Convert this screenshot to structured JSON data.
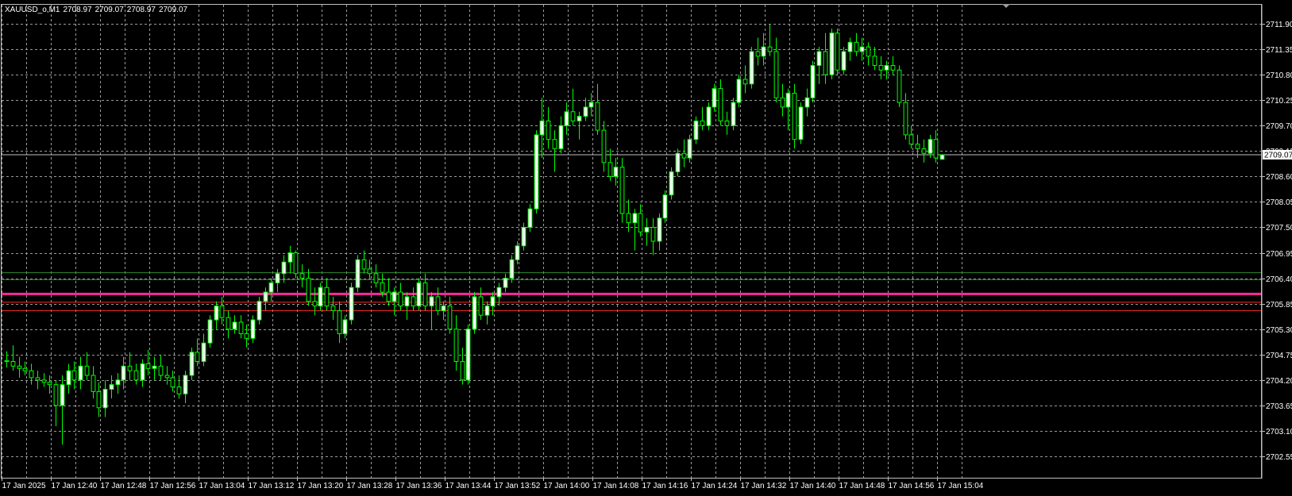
{
  "symbol_label": "XAUUSD_o,M1",
  "ohlc": {
    "open": "2708.97",
    "high": "2709.07",
    "low": "2708.97",
    "close": "2709.07"
  },
  "current_price_label": "2709.07",
  "colors": {
    "background": "#000000",
    "grid": "#9a9a9a",
    "bull_candle": "#ffffff",
    "bear_candle": "#000000",
    "wick": "#00ff00",
    "price_line": "#c0c0c0",
    "magenta_line": "#ff2aa0",
    "red_line": "#ff2a2a",
    "green_line": "#2e8b2e"
  },
  "chart_data": {
    "type": "candlestick",
    "symbol": "XAUUSD_o",
    "timeframe": "M1",
    "ylim": [
      2702.55,
      2712.2
    ],
    "y_ticks": [
      "2711.90",
      "2711.35",
      "2710.80",
      "2710.25",
      "2709.70",
      "2709.15",
      "2708.60",
      "2708.05",
      "2707.50",
      "2706.95",
      "2706.40",
      "2705.85",
      "2705.30",
      "2704.75",
      "2704.20",
      "2703.65",
      "2703.10",
      "2702.55"
    ],
    "x_ticks": [
      "17 Jan 2025",
      "17 Jan 12:40",
      "17 Jan 12:48",
      "17 Jan 12:56",
      "17 Jan 13:04",
      "17 Jan 13:12",
      "17 Jan 13:20",
      "17 Jan 13:28",
      "17 Jan 13:36",
      "17 Jan 13:44",
      "17 Jan 13:52",
      "17 Jan 14:00",
      "17 Jan 14:08",
      "17 Jan 14:16",
      "17 Jan 14:24",
      "17 Jan 14:32",
      "17 Jan 14:40",
      "17 Jan 14:48",
      "17 Jan 14:56",
      "17 Jan 15:04"
    ],
    "bars_per_tick": 8,
    "horizontal_levels": [
      {
        "price": 2709.07,
        "style": "price_line"
      },
      {
        "price": 2706.52,
        "style": "green_line"
      },
      {
        "price": 2706.37,
        "style": "green_line"
      },
      {
        "price": 2706.06,
        "style": "magenta_line"
      },
      {
        "price": 2705.88,
        "style": "red_line"
      },
      {
        "price": 2705.7,
        "style": "red_line"
      }
    ],
    "candles": [
      [
        2704.62,
        2704.82,
        2704.47,
        2704.6
      ],
      [
        2704.6,
        2704.95,
        2704.4,
        2704.5
      ],
      [
        2704.5,
        2704.7,
        2704.25,
        2704.45
      ],
      [
        2704.45,
        2704.6,
        2704.3,
        2704.4
      ],
      [
        2704.4,
        2704.55,
        2704.1,
        2704.25
      ],
      [
        2704.25,
        2704.4,
        2704.0,
        2704.2
      ],
      [
        2704.2,
        2704.35,
        2704.05,
        2704.15
      ],
      [
        2704.15,
        2704.3,
        2703.9,
        2704.1
      ],
      [
        2704.1,
        2704.2,
        2703.2,
        2703.65
      ],
      [
        2703.65,
        2704.3,
        2702.8,
        2704.1
      ],
      [
        2704.1,
        2704.55,
        2703.9,
        2704.4
      ],
      [
        2704.4,
        2704.6,
        2704.0,
        2704.2
      ],
      [
        2704.2,
        2704.7,
        2704.0,
        2704.5
      ],
      [
        2704.5,
        2704.8,
        2704.2,
        2704.3
      ],
      [
        2704.3,
        2704.5,
        2703.8,
        2703.95
      ],
      [
        2703.95,
        2704.15,
        2703.4,
        2703.6
      ],
      [
        2703.6,
        2704.2,
        2703.4,
        2704.0
      ],
      [
        2704.0,
        2704.3,
        2703.8,
        2704.1
      ],
      [
        2704.1,
        2704.35,
        2703.9,
        2704.2
      ],
      [
        2704.2,
        2704.7,
        2704.0,
        2704.5
      ],
      [
        2704.5,
        2704.8,
        2704.2,
        2704.4
      ],
      [
        2704.4,
        2704.55,
        2704.1,
        2704.2
      ],
      [
        2704.2,
        2704.65,
        2704.05,
        2704.55
      ],
      [
        2704.55,
        2704.85,
        2704.3,
        2704.45
      ],
      [
        2704.45,
        2704.7,
        2704.2,
        2704.5
      ],
      [
        2704.5,
        2704.75,
        2704.2,
        2704.3
      ],
      [
        2704.3,
        2704.5,
        2704.1,
        2704.25
      ],
      [
        2704.25,
        2704.4,
        2703.95,
        2704.05
      ],
      [
        2704.05,
        2704.3,
        2703.8,
        2703.9
      ],
      [
        2703.9,
        2704.4,
        2703.7,
        2704.3
      ],
      [
        2704.3,
        2704.9,
        2704.2,
        2704.8
      ],
      [
        2704.8,
        2705.1,
        2704.5,
        2704.6
      ],
      [
        2704.6,
        2705.2,
        2704.5,
        2705.0
      ],
      [
        2705.0,
        2705.6,
        2704.9,
        2705.5
      ],
      [
        2705.5,
        2705.9,
        2705.3,
        2705.8
      ],
      [
        2705.8,
        2706.0,
        2705.4,
        2705.55
      ],
      [
        2705.55,
        2705.7,
        2705.1,
        2705.3
      ],
      [
        2705.3,
        2705.6,
        2705.2,
        2705.45
      ],
      [
        2705.45,
        2705.6,
        2705.1,
        2705.2
      ],
      [
        2705.2,
        2705.4,
        2704.9,
        2705.1
      ],
      [
        2705.1,
        2705.6,
        2705.0,
        2705.5
      ],
      [
        2705.5,
        2706.0,
        2705.4,
        2705.9
      ],
      [
        2705.9,
        2706.2,
        2705.7,
        2706.1
      ],
      [
        2706.1,
        2706.4,
        2705.9,
        2706.3
      ],
      [
        2706.3,
        2706.6,
        2706.1,
        2706.5
      ],
      [
        2706.5,
        2706.9,
        2706.3,
        2706.75
      ],
      [
        2706.75,
        2707.1,
        2706.5,
        2706.95
      ],
      [
        2706.95,
        2707.0,
        2706.4,
        2706.5
      ],
      [
        2706.5,
        2706.7,
        2706.2,
        2706.4
      ],
      [
        2706.4,
        2706.6,
        2705.8,
        2705.9
      ],
      [
        2705.9,
        2706.2,
        2705.6,
        2705.8
      ],
      [
        2705.8,
        2706.3,
        2705.7,
        2706.2
      ],
      [
        2706.2,
        2706.4,
        2705.7,
        2705.8
      ],
      [
        2705.8,
        2706.0,
        2705.5,
        2705.7
      ],
      [
        2705.7,
        2705.9,
        2705.0,
        2705.2
      ],
      [
        2705.2,
        2705.6,
        2705.1,
        2705.5
      ],
      [
        2705.5,
        2706.3,
        2705.4,
        2706.2
      ],
      [
        2706.2,
        2706.9,
        2706.1,
        2706.8
      ],
      [
        2706.8,
        2707.0,
        2706.5,
        2706.6
      ],
      [
        2706.6,
        2706.8,
        2706.4,
        2706.5
      ],
      [
        2706.5,
        2706.7,
        2706.2,
        2706.3
      ],
      [
        2706.3,
        2706.5,
        2706.0,
        2706.1
      ],
      [
        2706.1,
        2706.4,
        2705.8,
        2705.9
      ],
      [
        2705.9,
        2706.2,
        2705.6,
        2706.1
      ],
      [
        2706.1,
        2706.3,
        2705.7,
        2705.8
      ],
      [
        2705.8,
        2706.1,
        2705.5,
        2706.0
      ],
      [
        2706.0,
        2706.2,
        2705.7,
        2705.8
      ],
      [
        2705.8,
        2706.4,
        2705.7,
        2706.3
      ],
      [
        2706.3,
        2706.5,
        2705.7,
        2705.8
      ],
      [
        2705.8,
        2706.1,
        2705.3,
        2706.0
      ],
      [
        2706.0,
        2706.2,
        2705.6,
        2705.7
      ],
      [
        2705.7,
        2705.9,
        2705.5,
        2705.8
      ],
      [
        2705.8,
        2706.0,
        2705.2,
        2705.3
      ],
      [
        2705.3,
        2705.6,
        2704.4,
        2704.6
      ],
      [
        2704.6,
        2704.9,
        2704.1,
        2704.2
      ],
      [
        2704.2,
        2705.4,
        2704.1,
        2705.3
      ],
      [
        2705.3,
        2706.1,
        2705.2,
        2706.0
      ],
      [
        2706.0,
        2706.2,
        2705.5,
        2705.6
      ],
      [
        2705.6,
        2705.9,
        2705.4,
        2705.8
      ],
      [
        2705.8,
        2706.1,
        2705.6,
        2706.0
      ],
      [
        2706.0,
        2706.3,
        2705.8,
        2706.2
      ],
      [
        2706.2,
        2706.5,
        2706.1,
        2706.4
      ],
      [
        2706.4,
        2706.9,
        2706.3,
        2706.8
      ],
      [
        2706.8,
        2707.2,
        2706.7,
        2707.1
      ],
      [
        2707.1,
        2707.6,
        2707.0,
        2707.5
      ],
      [
        2707.5,
        2708.0,
        2707.4,
        2707.9
      ],
      [
        2707.9,
        2709.6,
        2707.8,
        2709.5
      ],
      [
        2709.5,
        2710.3,
        2709.0,
        2709.8
      ],
      [
        2709.8,
        2710.1,
        2709.2,
        2709.4
      ],
      [
        2709.4,
        2709.6,
        2708.7,
        2709.2
      ],
      [
        2709.2,
        2709.9,
        2709.1,
        2709.7
      ],
      [
        2709.7,
        2710.2,
        2709.5,
        2710.0
      ],
      [
        2710.0,
        2710.5,
        2709.7,
        2709.8
      ],
      [
        2709.8,
        2710.0,
        2709.4,
        2709.9
      ],
      [
        2709.9,
        2710.3,
        2709.8,
        2710.1
      ],
      [
        2710.1,
        2710.4,
        2709.9,
        2710.2
      ],
      [
        2710.2,
        2710.6,
        2709.5,
        2709.6
      ],
      [
        2709.6,
        2709.8,
        2708.7,
        2708.9
      ],
      [
        2708.9,
        2709.2,
        2708.5,
        2708.6
      ],
      [
        2708.6,
        2709.0,
        2708.4,
        2708.8
      ],
      [
        2708.8,
        2709.0,
        2707.6,
        2707.8
      ],
      [
        2707.8,
        2708.1,
        2707.4,
        2707.6
      ],
      [
        2707.6,
        2707.9,
        2707.0,
        2707.8
      ],
      [
        2707.8,
        2708.0,
        2707.3,
        2707.4
      ],
      [
        2707.4,
        2707.7,
        2707.1,
        2707.5
      ],
      [
        2707.5,
        2707.7,
        2706.9,
        2707.2
      ],
      [
        2707.2,
        2707.8,
        2707.0,
        2707.7
      ],
      [
        2707.7,
        2708.3,
        2707.6,
        2708.2
      ],
      [
        2708.2,
        2708.8,
        2708.1,
        2708.7
      ],
      [
        2708.7,
        2709.2,
        2708.6,
        2709.1
      ],
      [
        2709.1,
        2709.4,
        2708.8,
        2709.0
      ],
      [
        2709.0,
        2709.5,
        2708.9,
        2709.4
      ],
      [
        2709.4,
        2709.9,
        2709.3,
        2709.8
      ],
      [
        2709.8,
        2710.1,
        2709.6,
        2709.7
      ],
      [
        2709.7,
        2710.2,
        2709.6,
        2710.1
      ],
      [
        2710.1,
        2710.6,
        2710.0,
        2710.5
      ],
      [
        2710.5,
        2710.7,
        2709.7,
        2709.8
      ],
      [
        2709.8,
        2710.0,
        2709.5,
        2709.7
      ],
      [
        2709.7,
        2710.3,
        2709.6,
        2710.2
      ],
      [
        2710.2,
        2710.8,
        2710.1,
        2710.7
      ],
      [
        2710.7,
        2711.0,
        2710.4,
        2710.6
      ],
      [
        2710.6,
        2711.4,
        2710.5,
        2711.3
      ],
      [
        2711.3,
        2711.6,
        2711.0,
        2711.2
      ],
      [
        2711.2,
        2711.7,
        2711.0,
        2711.4
      ],
      [
        2711.4,
        2711.9,
        2711.2,
        2711.3
      ],
      [
        2711.3,
        2711.6,
        2710.2,
        2710.3
      ],
      [
        2710.3,
        2710.6,
        2709.9,
        2710.1
      ],
      [
        2710.1,
        2710.5,
        2709.6,
        2710.4
      ],
      [
        2710.4,
        2710.6,
        2709.2,
        2709.4
      ],
      [
        2709.4,
        2710.2,
        2709.3,
        2710.1
      ],
      [
        2710.1,
        2710.5,
        2709.9,
        2710.3
      ],
      [
        2710.3,
        2711.1,
        2710.2,
        2711.0
      ],
      [
        2711.0,
        2711.4,
        2710.6,
        2711.3
      ],
      [
        2711.3,
        2711.7,
        2710.6,
        2710.8
      ],
      [
        2710.8,
        2711.8,
        2710.7,
        2711.7
      ],
      [
        2711.7,
        2711.8,
        2710.8,
        2710.9
      ],
      [
        2710.9,
        2711.4,
        2710.8,
        2711.3
      ],
      [
        2711.3,
        2711.6,
        2711.1,
        2711.5
      ],
      [
        2711.5,
        2711.7,
        2711.2,
        2711.3
      ],
      [
        2711.3,
        2711.6,
        2711.1,
        2711.4
      ],
      [
        2711.4,
        2711.5,
        2711.0,
        2711.2
      ],
      [
        2711.2,
        2711.4,
        2710.9,
        2711.0
      ],
      [
        2711.0,
        2711.2,
        2710.7,
        2710.9
      ],
      [
        2710.9,
        2711.1,
        2710.7,
        2711.0
      ],
      [
        2711.0,
        2711.2,
        2710.8,
        2710.9
      ],
      [
        2710.9,
        2711.0,
        2710.1,
        2710.2
      ],
      [
        2710.2,
        2710.4,
        2709.4,
        2709.5
      ],
      [
        2709.5,
        2709.7,
        2709.2,
        2709.3
      ],
      [
        2709.3,
        2709.5,
        2709.0,
        2709.2
      ],
      [
        2709.2,
        2709.4,
        2708.9,
        2709.1
      ],
      [
        2709.1,
        2709.5,
        2709.0,
        2709.4
      ],
      [
        2709.4,
        2709.6,
        2708.9,
        2709.0
      ],
      [
        2708.97,
        2709.07,
        2708.97,
        2709.07
      ]
    ]
  }
}
